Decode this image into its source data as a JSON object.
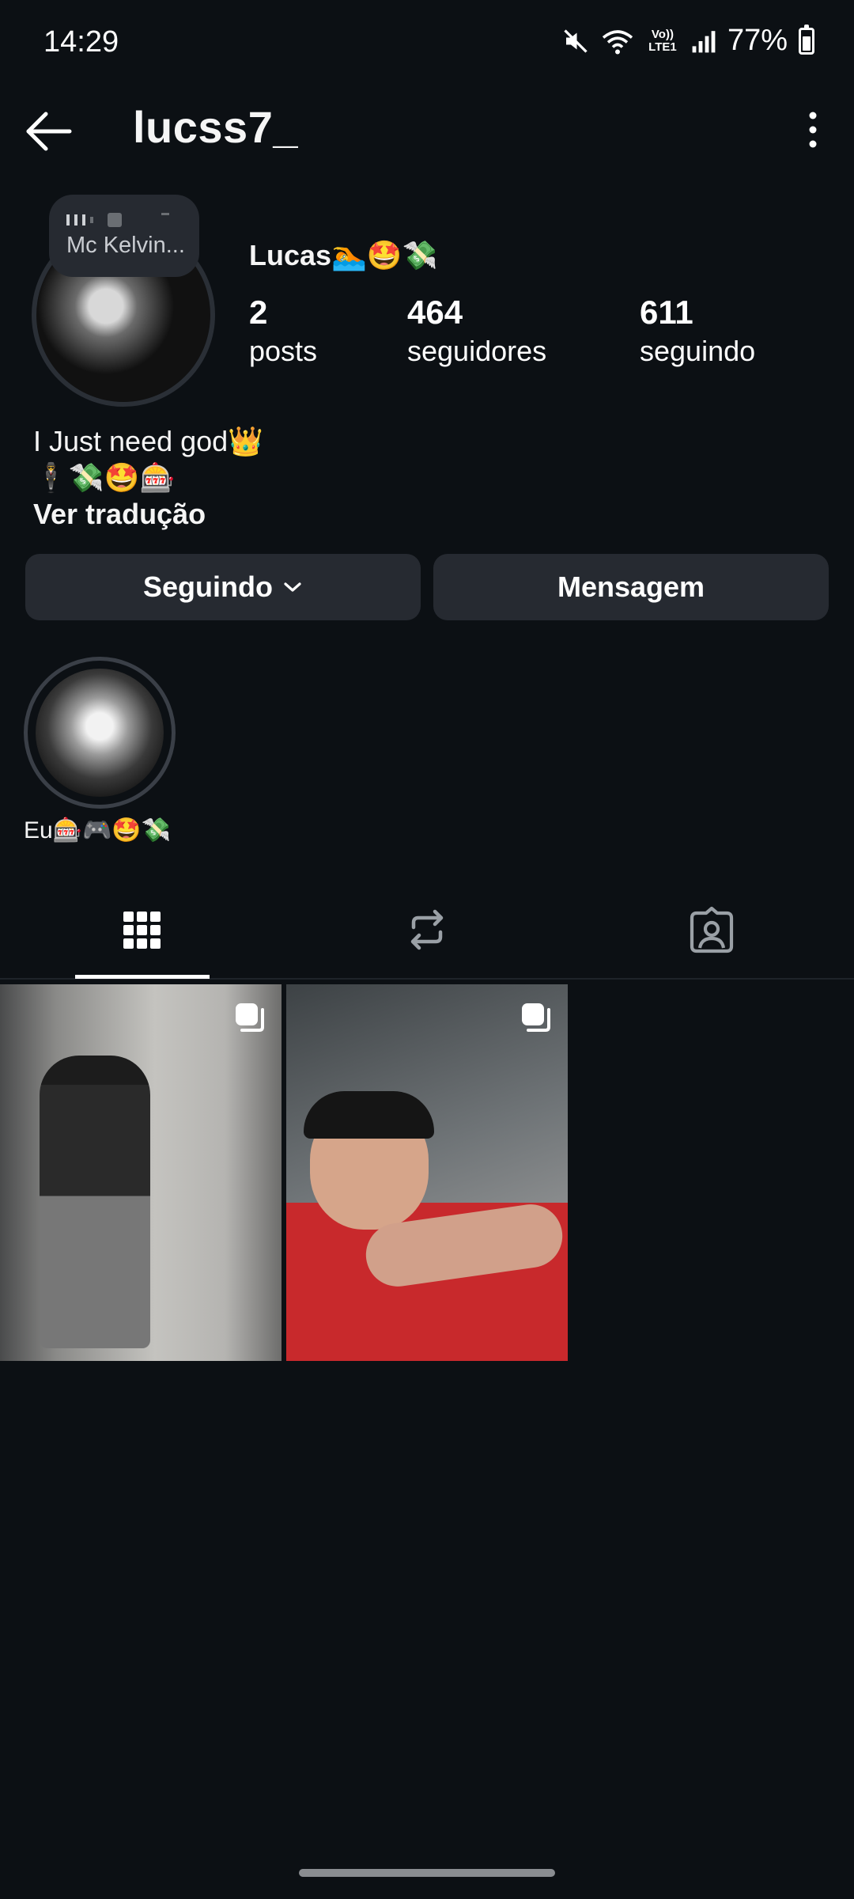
{
  "status_bar": {
    "time": "14:29",
    "network_label": "Vo)) LTE1",
    "battery_percent": "77%",
    "battery_level": 0.77
  },
  "header": {
    "username": "lucss7_"
  },
  "profile": {
    "note_text": "Mc Kelvin...",
    "full_name": "Lucas🏊🤩💸",
    "stats": {
      "posts_count": "2",
      "posts_label": "posts",
      "followers_count": "464",
      "followers_label": "seguidores",
      "following_count": "611",
      "following_label": "seguindo"
    },
    "bio_line1": "I Just need god👑",
    "bio_line2": "🕴️💸🤩🎰",
    "translate_label": "Ver tradução"
  },
  "actions": {
    "following_label": "Seguindo",
    "message_label": "Mensagem"
  },
  "highlights": [
    {
      "label": "Eu🎰🎮🤩💸"
    }
  ],
  "tabs": [
    {
      "icon": "grid-icon",
      "active": true
    },
    {
      "icon": "reels-repost-icon",
      "active": false
    },
    {
      "icon": "tagged-icon",
      "active": false
    }
  ],
  "posts": [
    {
      "type": "carousel"
    },
    {
      "type": "carousel"
    }
  ],
  "colors": {
    "background": "#0c1014",
    "button": "#262a31",
    "text": "#f5f5f5"
  }
}
